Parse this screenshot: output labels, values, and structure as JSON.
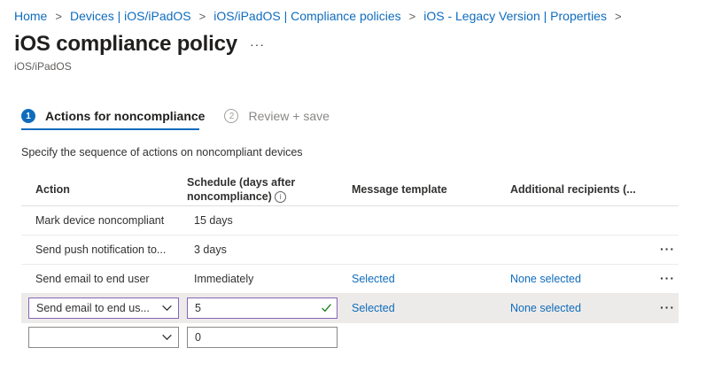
{
  "breadcrumb": [
    {
      "label": "Home"
    },
    {
      "label": "Devices | iOS/iPadOS"
    },
    {
      "label": "iOS/iPadOS | Compliance policies"
    },
    {
      "label": "iOS - Legacy Version | Properties"
    }
  ],
  "page": {
    "title": "iOS compliance policy",
    "more": "···",
    "subtitle": "iOS/iPadOS"
  },
  "steps": [
    {
      "num": "1",
      "label": "Actions for noncompliance",
      "active": true
    },
    {
      "num": "2",
      "label": "Review + save",
      "active": false
    }
  ],
  "description": "Specify the sequence of actions on noncompliant devices",
  "table": {
    "headers": {
      "action": "Action",
      "schedule_line1": "Schedule (days after",
      "schedule_line2": "noncompliance)",
      "message": "Message template",
      "recipients": "Additional recipients (..."
    },
    "rows": [
      {
        "action": "Mark device noncompliant",
        "schedule": "15 days",
        "message": "",
        "recipients": "",
        "more": ""
      },
      {
        "action": "Send push notification to...",
        "schedule": "3 days",
        "message": "",
        "recipients": "",
        "more": "···"
      },
      {
        "action": "Send email to end user",
        "schedule": "Immediately",
        "message": "Selected",
        "recipients": "None selected",
        "more": "···"
      }
    ],
    "edit_row": {
      "action": "Send email to end us...",
      "schedule": "5",
      "message": "Selected",
      "recipients": "None selected",
      "more": "···"
    },
    "new_row": {
      "action": "",
      "schedule": "0"
    }
  },
  "colors": {
    "accent": "#0f6cbd",
    "focus_border": "#8764b8",
    "valid_check": "#107c10"
  }
}
